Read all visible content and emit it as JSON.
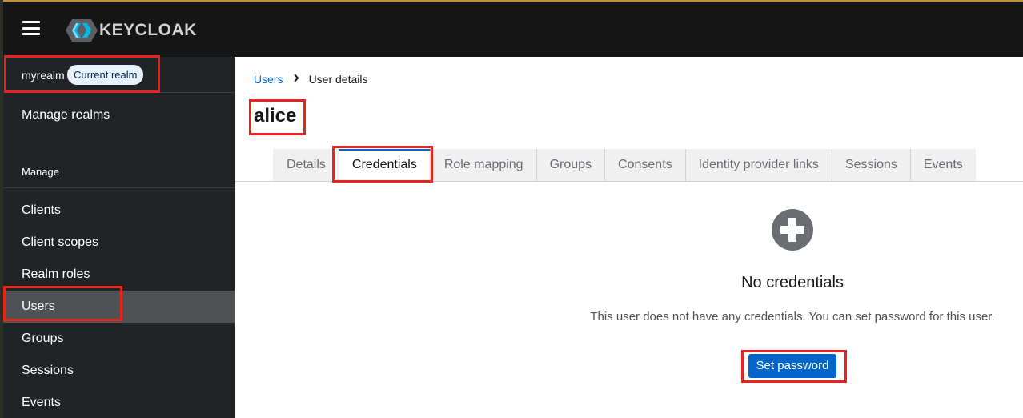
{
  "masthead": {
    "logo_text": "KEYCLOAK",
    "icon": "hamburger-menu-icon"
  },
  "sidebar": {
    "realm_name": "myrealm",
    "realm_badge": "Current realm",
    "manage_realms": "Manage realms",
    "section_label": "Manage",
    "items": [
      {
        "label": "Clients",
        "active": false
      },
      {
        "label": "Client scopes",
        "active": false
      },
      {
        "label": "Realm roles",
        "active": false
      },
      {
        "label": "Users",
        "active": true
      },
      {
        "label": "Groups",
        "active": false
      },
      {
        "label": "Sessions",
        "active": false
      },
      {
        "label": "Events",
        "active": false
      }
    ]
  },
  "breadcrumb": {
    "link": "Users",
    "separator_icon": "chevron-right-icon",
    "current": "User details"
  },
  "page": {
    "title": "alice"
  },
  "tabs": [
    {
      "label": "Details",
      "active": false
    },
    {
      "label": "Credentials",
      "active": true
    },
    {
      "label": "Role mapping",
      "active": false
    },
    {
      "label": "Groups",
      "active": false
    },
    {
      "label": "Consents",
      "active": false
    },
    {
      "label": "Identity provider links",
      "active": false
    },
    {
      "label": "Sessions",
      "active": false
    },
    {
      "label": "Events",
      "active": false
    }
  ],
  "empty_state": {
    "icon": "plus-circle-icon",
    "title": "No credentials",
    "body": "This user does not have any credentials. You can set password for this user.",
    "button_label": "Set password"
  },
  "colors": {
    "masthead_bg": "#151515",
    "sidebar_bg": "#212427",
    "active_nav_bg": "#4f5255",
    "primary": "#0066cc",
    "annotation_red": "#e8231b"
  }
}
